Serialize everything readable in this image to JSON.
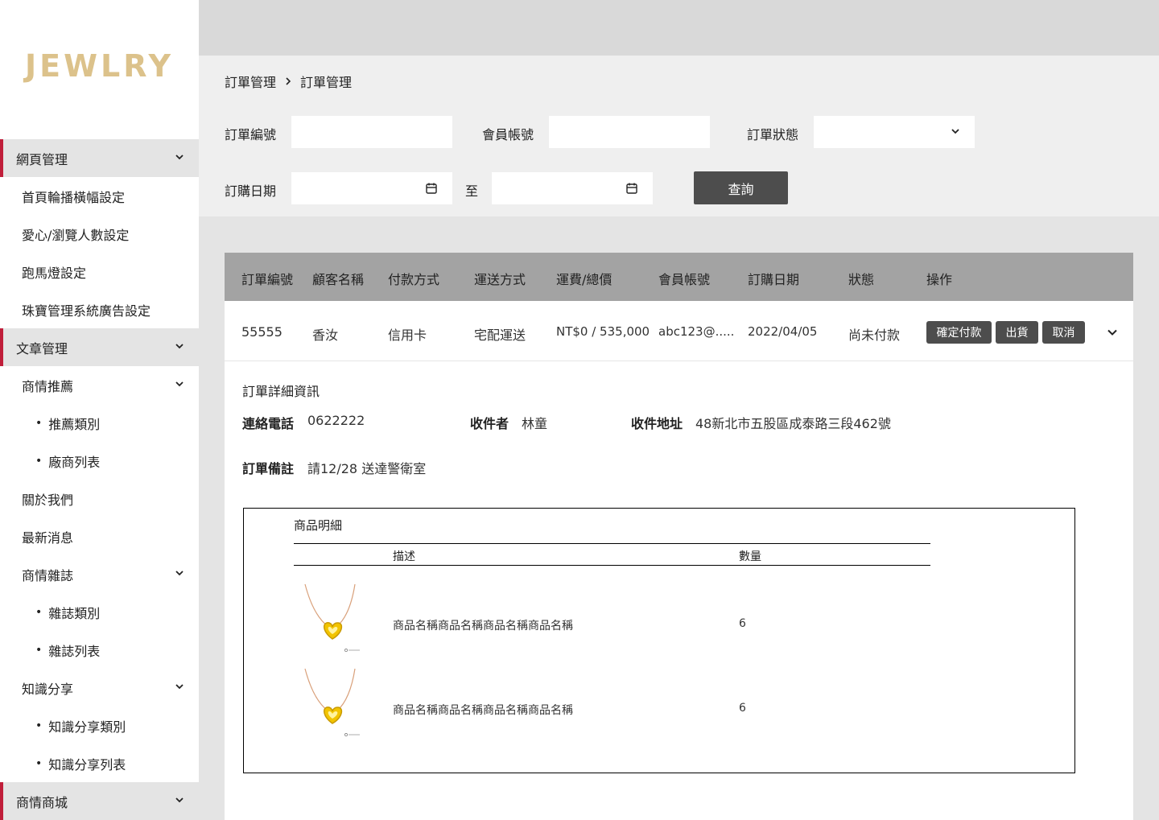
{
  "brand": {
    "logo": "JEWLRY",
    "logo_color": "#dcc28b",
    "accent": "#c01e3a"
  },
  "sidebar": {
    "items": [
      {
        "label": "網頁管理",
        "level": "group",
        "chevron": true
      },
      {
        "label": "首頁輪播橫幅設定",
        "level": "child",
        "chevron": false
      },
      {
        "label": "愛心/瀏覽人數設定",
        "level": "child",
        "chevron": false
      },
      {
        "label": "跑馬燈設定",
        "level": "child",
        "chevron": false
      },
      {
        "label": "珠寶管理系統廣告設定",
        "level": "child",
        "chevron": false
      },
      {
        "label": "文章管理",
        "level": "group",
        "chevron": true
      },
      {
        "label": "商情推薦",
        "level": "child",
        "chevron": true
      },
      {
        "label": "推薦類別",
        "level": "grand",
        "chevron": false
      },
      {
        "label": "廠商列表",
        "level": "grand",
        "chevron": false
      },
      {
        "label": "關於我們",
        "level": "child",
        "chevron": false
      },
      {
        "label": "最新消息",
        "level": "child",
        "chevron": false
      },
      {
        "label": "商情雜誌",
        "level": "child",
        "chevron": true
      },
      {
        "label": "雜誌類別",
        "level": "grand",
        "chevron": false
      },
      {
        "label": "雜誌列表",
        "level": "grand",
        "chevron": false
      },
      {
        "label": "知識分享",
        "level": "child",
        "chevron": true
      },
      {
        "label": "知識分享類別",
        "level": "grand",
        "chevron": false
      },
      {
        "label": "知識分享列表",
        "level": "grand",
        "chevron": false
      },
      {
        "label": "商情商城",
        "level": "group",
        "chevron": true
      }
    ]
  },
  "breadcrumb": {
    "parent": "訂單管理",
    "current": "訂單管理"
  },
  "filter": {
    "order_no_label": "訂單編號",
    "order_no_value": "",
    "member_label": "會員帳號",
    "member_value": "",
    "status_label": "訂單狀態",
    "status_value": "",
    "date_label": "訂購日期",
    "date_from": "",
    "date_to_label": "至",
    "date_to": "",
    "query_button": "查詢"
  },
  "table": {
    "headers": [
      "訂單編號",
      "顧客名稱",
      "付款方式",
      "運送方式",
      "運費/總價",
      "會員帳號",
      "訂購日期",
      "狀態",
      "操作"
    ],
    "row": {
      "order_no": "55555",
      "customer": "香汝",
      "payment": "信用卡",
      "shipping": "宅配運送",
      "price": "NT$0 / 535,000",
      "member": "abc123@.....",
      "date": "2022/04/05",
      "status": "尚未付款",
      "actions": {
        "confirm": "確定付款",
        "ship": "出貨",
        "cancel": "取消"
      }
    }
  },
  "detail": {
    "title": "訂單詳細資訊",
    "phone_label": "連絡電話",
    "phone": "0622222",
    "recipient_label": "收件者",
    "recipient": "林童",
    "address_label": "收件地址",
    "address": "48新北市五股區成泰路三段462號",
    "note_label": "訂單備註",
    "note": "請12/28 送達警衛室"
  },
  "goods": {
    "title": "商品明細",
    "col_desc": "描述",
    "col_qty": "數量",
    "items": [
      {
        "name": "商品名稱商品名稱商品名稱商品名稱",
        "qty": "6",
        "image_icon": "heart-necklace-icon"
      },
      {
        "name": "商品名稱商品名稱商品名稱商品名稱",
        "qty": "6",
        "image_icon": "heart-necklace-icon"
      }
    ]
  }
}
